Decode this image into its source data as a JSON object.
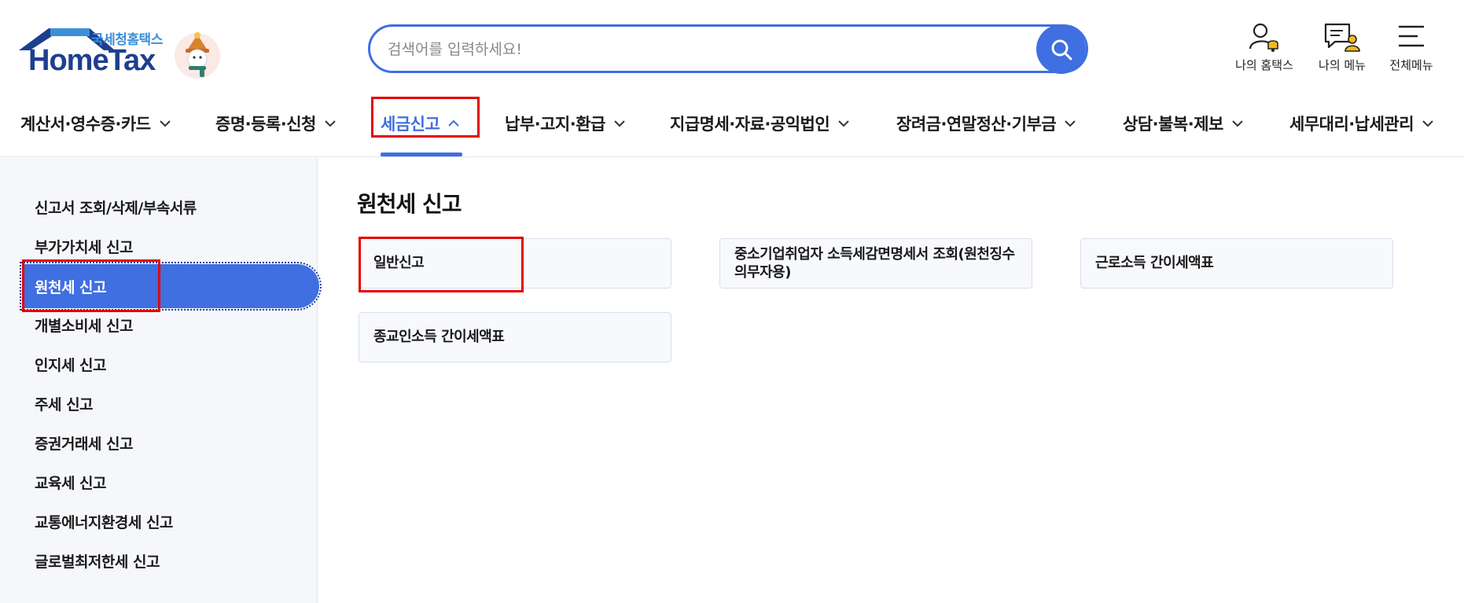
{
  "brand": {
    "sub_title": "국세청홈택스",
    "main_title": "HomeTax",
    "colors": {
      "primary": "#3f6fe0",
      "navy": "#1d3f8f",
      "highlight": "#e30000"
    }
  },
  "search": {
    "placeholder": "검색어를 입력하세요!"
  },
  "utility": [
    {
      "label": "나의 홈택스",
      "icon": "user-bell-icon"
    },
    {
      "label": "나의 메뉴",
      "icon": "menu-user-icon"
    },
    {
      "label": "전체메뉴",
      "icon": "hamburger-icon"
    }
  ],
  "gnb": [
    {
      "label": "계산서·영수증·카드",
      "active": false
    },
    {
      "label": "증명·등록·신청",
      "active": false
    },
    {
      "label": "세금신고",
      "active": true
    },
    {
      "label": "납부·고지·환급",
      "active": false
    },
    {
      "label": "지급명세·자료·공익법인",
      "active": false
    },
    {
      "label": "장려금·연말정산·기부금",
      "active": false
    },
    {
      "label": "상담·불복·제보",
      "active": false
    },
    {
      "label": "세무대리·납세관리",
      "active": false
    }
  ],
  "lnb": [
    {
      "label": "신고서 조회/삭제/부속서류"
    },
    {
      "label": "부가가치세 신고"
    },
    {
      "label": "원천세 신고",
      "active": true
    },
    {
      "label": "개별소비세 신고"
    },
    {
      "label": "인지세 신고"
    },
    {
      "label": "주세 신고"
    },
    {
      "label": "증권거래세 신고"
    },
    {
      "label": "교육세 신고"
    },
    {
      "label": "교통에너지환경세 신고"
    },
    {
      "label": "글로벌최저한세 신고"
    }
  ],
  "content": {
    "title": "원천세 신고",
    "cards": [
      {
        "label": "일반신고"
      },
      {
        "label": "중소기업취업자 소득세감면명세서 조회(원천징수의무자용)"
      },
      {
        "label": "근로소득 간이세액표"
      },
      {
        "label": "종교인소득 간이세액표"
      }
    ]
  }
}
